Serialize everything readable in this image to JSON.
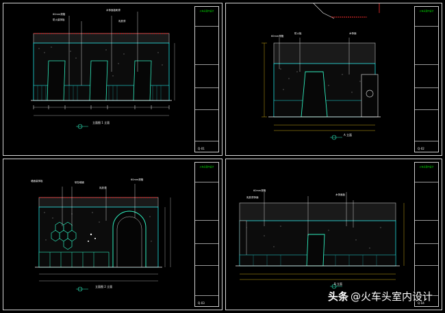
{
  "watermark": {
    "brand": "头条",
    "handle": "@火车头室内设计"
  },
  "sheets": [
    {
      "company": "火车头室内设计",
      "drawing_no": "Q-01",
      "view_title": "立面图 1 立面",
      "labels": [
        "60mm规格",
        "防火装饰板",
        "木饰面板刷漆",
        "乳胶漆"
      ]
    },
    {
      "company": "火车头室内设计",
      "drawing_no": "Q-02",
      "view_title": "A 立面",
      "labels": [
        "60mm规格",
        "防火板",
        "木饰面"
      ]
    },
    {
      "company": "火车头室内设计",
      "drawing_no": "Q-03",
      "view_title": "立面图 2 立面",
      "labels": [
        "墙面装饰板",
        "软包墙面",
        "乳胶漆",
        "60mm规格"
      ]
    },
    {
      "company": "火车头室内设计",
      "drawing_no": "Q-04",
      "view_title": "B 立面",
      "labels": [
        "60mm规格",
        "乳胶漆饰面",
        "木饰面板"
      ]
    }
  ]
}
